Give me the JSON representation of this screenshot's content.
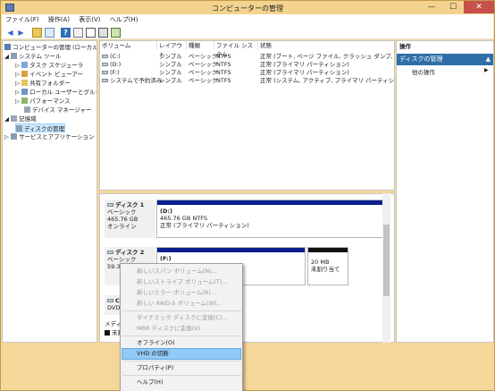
{
  "window": {
    "title": "コンピューターの管理",
    "buttons": {
      "minimize": "—",
      "maximize": "☐",
      "close": "✕"
    }
  },
  "menubar": [
    "ファイル(F)",
    "操作(A)",
    "表示(V)",
    "ヘルプ(H)"
  ],
  "toolbar": [
    "back-icon",
    "forward-icon",
    "up-icon",
    "show-hide-tree-icon",
    "help-icon",
    "properties-icon",
    "refresh-icon",
    "export-icon",
    "settings-icon"
  ],
  "tree": [
    {
      "label": "コンピューターの管理 (ローカル)",
      "icon": "computer-management-icon",
      "level": 0
    },
    {
      "label": "システム ツール",
      "icon": "tools-icon",
      "level": 1,
      "expander": "◢"
    },
    {
      "label": "タスク スケジューラ",
      "icon": "task-scheduler-icon",
      "level": 2,
      "expander": "▷"
    },
    {
      "label": "イベント ビューアー",
      "icon": "event-viewer-icon",
      "level": 2,
      "expander": "▷"
    },
    {
      "label": "共有フォルダー",
      "icon": "shared-folder-icon",
      "level": 2,
      "expander": "▷"
    },
    {
      "label": "ローカル ユーザーとグループ",
      "icon": "users-icon",
      "level": 2,
      "expander": "▷"
    },
    {
      "label": "パフォーマンス",
      "icon": "performance-icon",
      "level": 2,
      "expander": "▷"
    },
    {
      "label": "デバイス マネージャー",
      "icon": "device-manager-icon",
      "level": 2
    },
    {
      "label": "記憶域",
      "icon": "storage-icon",
      "level": 1,
      "expander": "◢"
    },
    {
      "label": "ディスクの管理",
      "icon": "disk-management-icon",
      "level": 2,
      "selected": true
    },
    {
      "label": "サービスとアプリケーション",
      "icon": "services-icon",
      "level": 1,
      "expander": "▷"
    }
  ],
  "volume_table": {
    "headers": [
      "ボリューム",
      "レイアウト",
      "種類",
      "ファイル システム",
      "状態"
    ],
    "rows": [
      [
        "(C:)",
        "シンプル",
        "ベーシック",
        "NTFS",
        "正常 (ブート, ページ ファイル, クラッシュ ダンプ, プライマリ"
      ],
      [
        "(D:)",
        "シンプル",
        "ベーシック",
        "NTFS",
        "正常 (プライマリ パーティション)"
      ],
      [
        "(F:)",
        "シンプル",
        "ベーシック",
        "NTFS",
        "正常 (プライマリ パーティション)"
      ],
      [
        "システムで予約済み",
        "シンプル",
        "ベーシック",
        "NTFS",
        "正常 (システム, アクティブ, プライマリ パーティション)"
      ]
    ]
  },
  "disks": [
    {
      "name": "ディスク 1",
      "type": "ベーシック",
      "size": "465.76 GB",
      "status": "オンライン",
      "partition": {
        "name": "(D:)",
        "size": "465.76 GB NTFS",
        "status": "正常 (プライマリ パーティション)"
      }
    },
    {
      "name": "ディスク 2",
      "type": "ベーシック",
      "size": "59.30",
      "partition": {
        "name": "(F:)"
      },
      "unallocated": {
        "size": "20 MB",
        "label": "未割り当て"
      }
    }
  ],
  "disk3_fragments": {
    "name_prefix": "C",
    "type": "DVD",
    "media": "メディア",
    "legend": "未割"
  },
  "actions": {
    "header": "操作",
    "section": "ディスクの管理",
    "section_arrow": "▲",
    "item": "他の操作",
    "item_arrow": "▶"
  },
  "context_menu": {
    "items": [
      {
        "label": "新しいスパン ボリューム(N)...",
        "disabled": true
      },
      {
        "label": "新しいストライプ ボリューム(T)...",
        "disabled": true
      },
      {
        "label": "新しいミラー ボリューム(R)...",
        "disabled": true
      },
      {
        "label": "新しい RAID-5 ボリューム(W)...",
        "disabled": true
      },
      {
        "label": "ダイナミック ディスクに変換(C)...",
        "disabled": true
      },
      {
        "label": "MBR ディスクに変換(V)",
        "disabled": true
      },
      {
        "label": "オフライン(O)",
        "disabled": false
      },
      {
        "label": "VHD の切断",
        "disabled": false,
        "highlighted": true
      },
      {
        "label": "プロパティ(P)",
        "disabled": false
      },
      {
        "label": "ヘルプ(H)",
        "disabled": false
      }
    ]
  },
  "colors": {
    "primary_partition": "#0a1f8f",
    "unallocated": "#111111",
    "highlight": "#91c9f7",
    "action_selected": "#2f6fa8"
  }
}
